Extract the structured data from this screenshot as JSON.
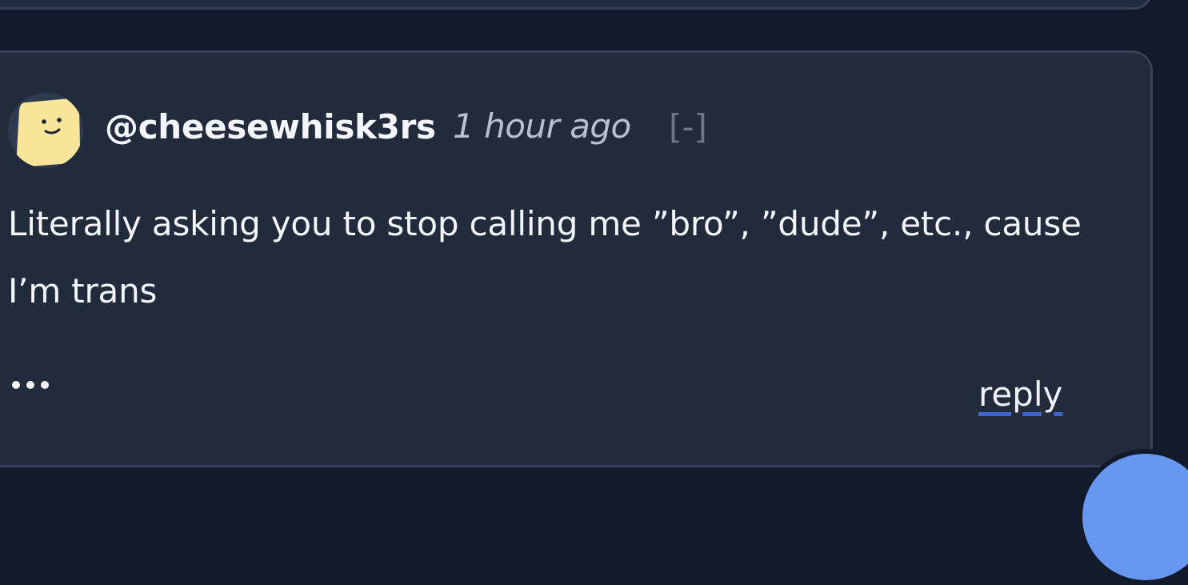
{
  "comment": {
    "username": "@cheesewhisk3rs",
    "timestamp": "1 hour ago",
    "collapse_label": "[-]",
    "body": "Literally asking you to stop calling me ”bro”, ”dude”, etc., cause I’m trans",
    "more_icon": "more-dots-icon",
    "reply_label": "reply",
    "avatar_icon": "smiley-face-icon"
  },
  "colors": {
    "page_background": "#131a2c",
    "card_background": "#212b3c",
    "card_border": "#364157",
    "avatar_fill": "#f8e59a",
    "reply_underline": "#3f63cf",
    "fab": "#6798f0"
  }
}
